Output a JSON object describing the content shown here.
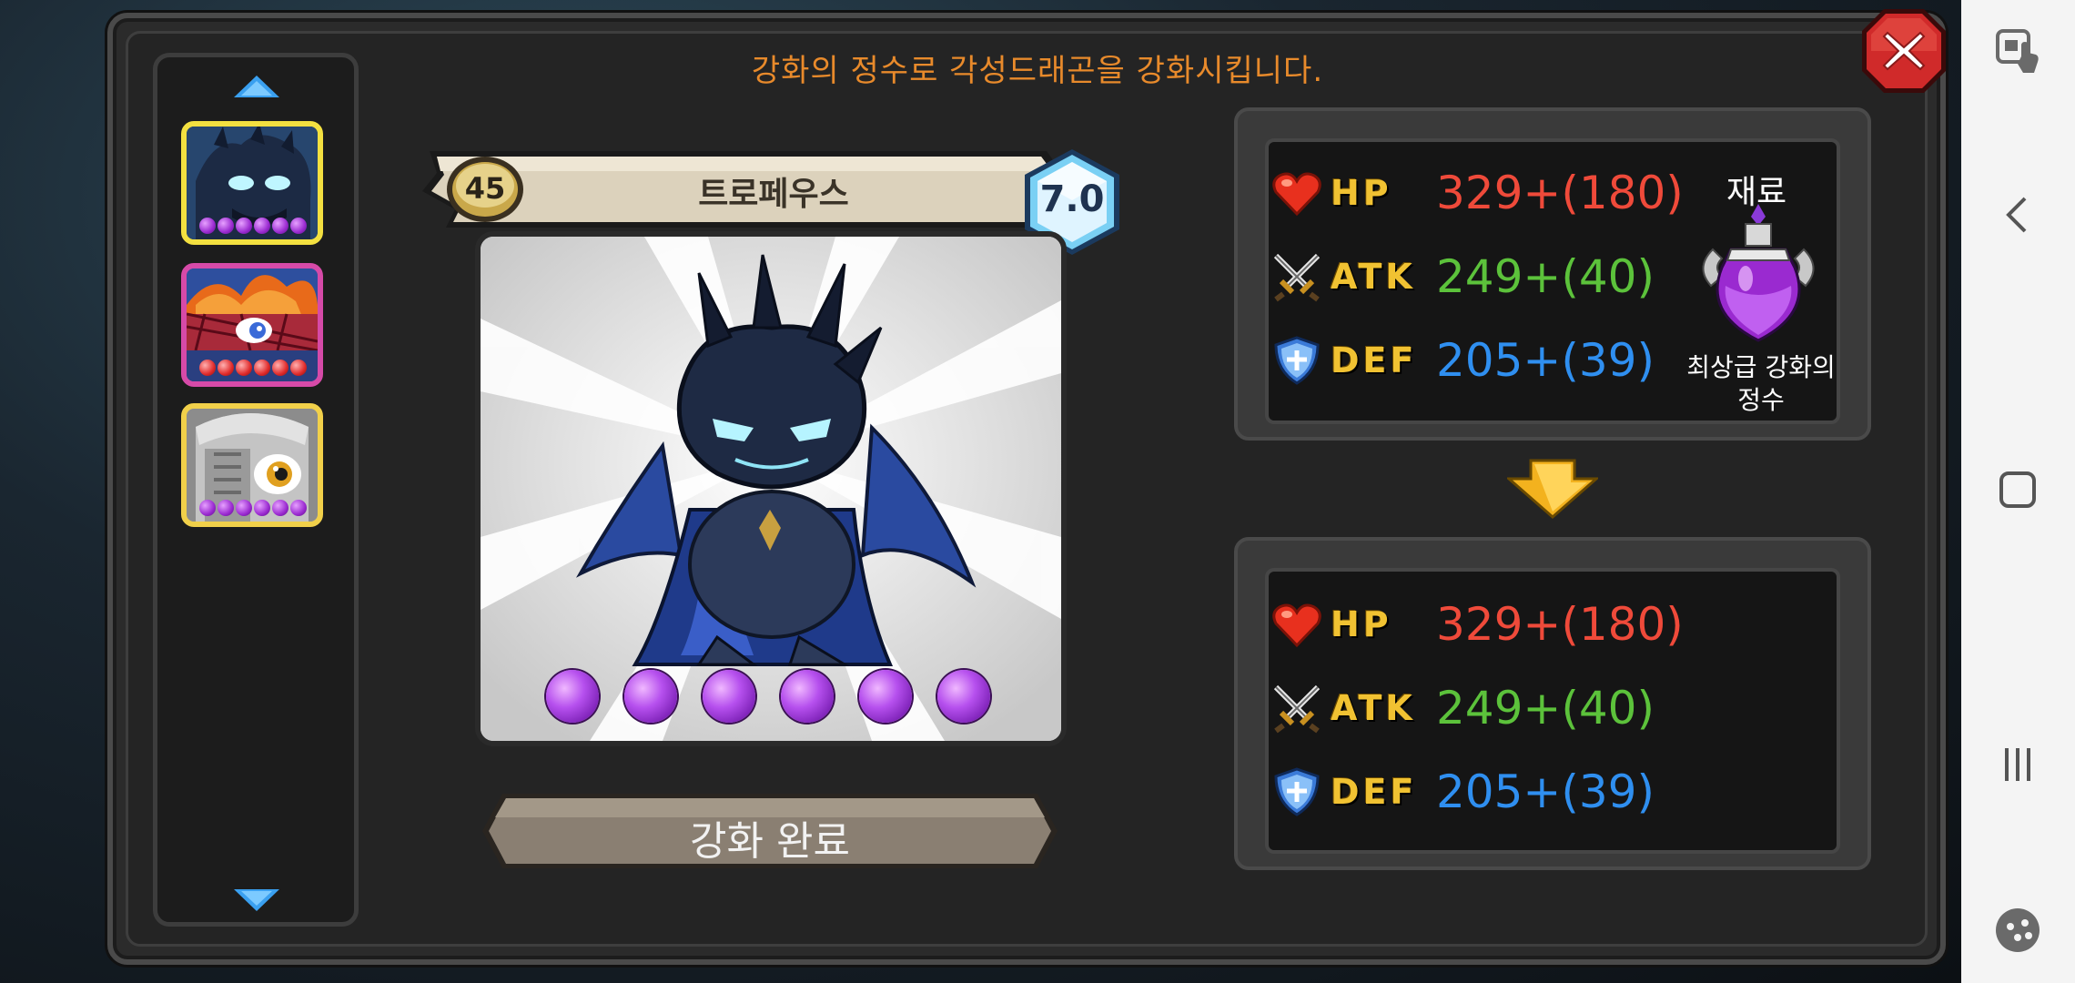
{
  "dialog": {
    "instruction": "강화의 정수로 각성드래곤을 강화시킵니다."
  },
  "list": {
    "items": [
      {
        "name": "dark-dragon",
        "selected": true
      },
      {
        "name": "flame-dragon",
        "selected": false
      },
      {
        "name": "armored-dragon",
        "selected": false
      }
    ]
  },
  "card": {
    "level": "45",
    "name": "트로페우스",
    "grade": "7.0",
    "orb_count": 6
  },
  "upgrade_button": {
    "label": "강화 완료"
  },
  "stats_before": {
    "hp": {
      "label": "HP",
      "value": "329+(180)"
    },
    "atk": {
      "label": "ATK",
      "value": "249+(40)"
    },
    "def": {
      "label": "DEF",
      "value": "205+(39)"
    }
  },
  "stats_after": {
    "hp": {
      "label": "HP",
      "value": "329+(180)"
    },
    "atk": {
      "label": "ATK",
      "value": "249+(40)"
    },
    "def": {
      "label": "DEF",
      "value": "205+(39)"
    }
  },
  "material": {
    "title": "재료",
    "name_line1": "최상급 강화의",
    "name_line2": "정수"
  },
  "icons": {
    "hp": "heart-icon",
    "atk": "crossed-swords-icon",
    "def": "shield-icon",
    "close": "close-icon",
    "material": "essence-potion-icon"
  },
  "colors": {
    "instruction": "#e88a2b",
    "hp": "#ef4a3a",
    "atk": "#5cc23b",
    "def": "#2f8ff0",
    "stat_label": "#f1c232"
  }
}
